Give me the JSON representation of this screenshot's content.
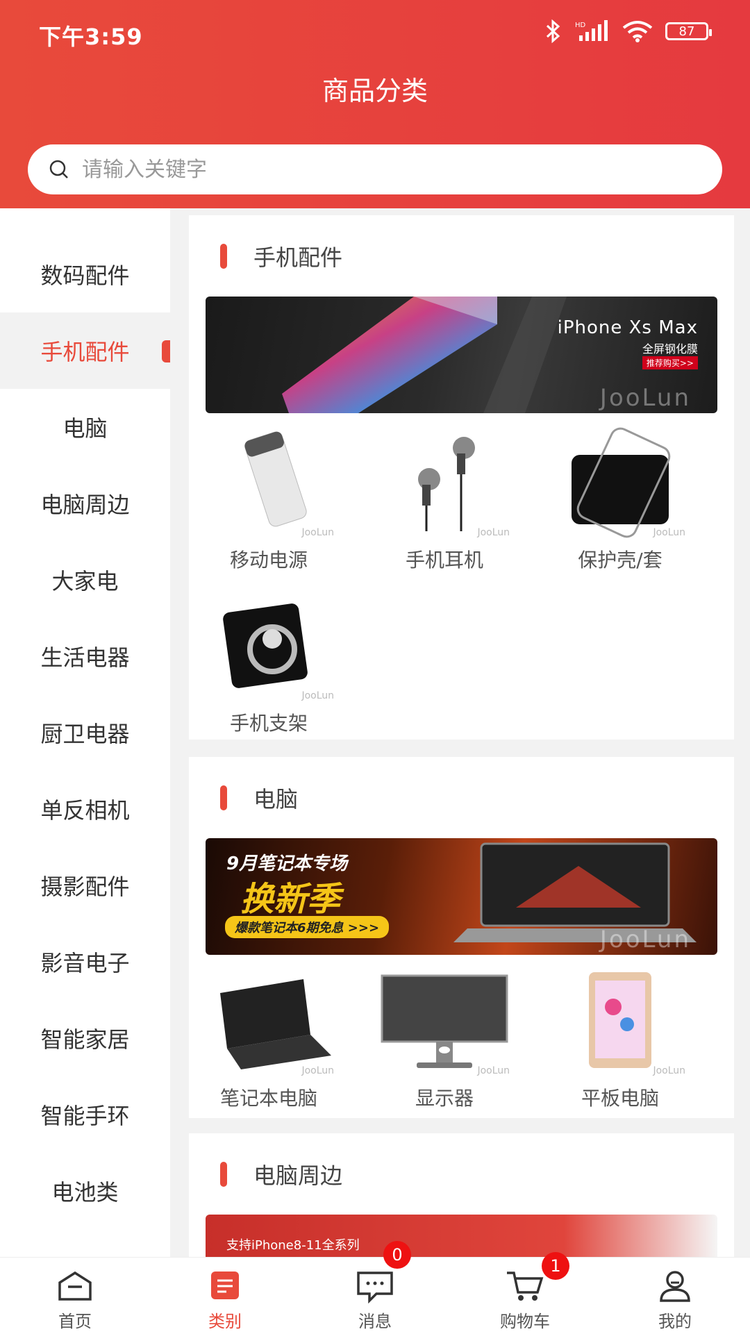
{
  "status_bar": {
    "time": "下午3:59",
    "battery": "87"
  },
  "header": {
    "title": "商品分类"
  },
  "search": {
    "placeholder": "请输入关键字"
  },
  "sidebar": {
    "items": [
      {
        "label": "数码配件"
      },
      {
        "label": "手机配件"
      },
      {
        "label": "电脑"
      },
      {
        "label": "电脑周边"
      },
      {
        "label": "大家电"
      },
      {
        "label": "生活电器"
      },
      {
        "label": "厨卫电器"
      },
      {
        "label": "单反相机"
      },
      {
        "label": "摄影配件"
      },
      {
        "label": "影音电子"
      },
      {
        "label": "智能家居"
      },
      {
        "label": "智能手环"
      },
      {
        "label": "电池类"
      }
    ],
    "active_index": 1
  },
  "sections": [
    {
      "title": "手机配件",
      "banner": {
        "headline": "iPhone Xs Max",
        "sub": "全屏钢化膜",
        "tag": "推荐购买>>",
        "watermark": "JooLun"
      },
      "items": [
        {
          "label": "移动电源",
          "icon": "power-bank"
        },
        {
          "label": "手机耳机",
          "icon": "earphones"
        },
        {
          "label": "保护壳/套",
          "icon": "phone-case"
        },
        {
          "label": "手机支架",
          "icon": "phone-ring-holder"
        }
      ]
    },
    {
      "title": "电脑",
      "banner": {
        "headline": "9月笔记本专场",
        "big": "换新季",
        "sub": "爆款笔记本6期免息 >>>",
        "watermark": "JooLun"
      },
      "items": [
        {
          "label": "笔记本电脑",
          "icon": "laptop"
        },
        {
          "label": "显示器",
          "icon": "monitor"
        },
        {
          "label": "平板电脑",
          "icon": "tablet"
        }
      ]
    },
    {
      "title": "电脑周边",
      "banner": {
        "headline": "支持iPhone8-11全系列"
      }
    }
  ],
  "thumb_watermark": "JooLun",
  "tabbar": {
    "tabs": [
      {
        "label": "首页",
        "icon": "home-icon"
      },
      {
        "label": "类别",
        "icon": "category-icon"
      },
      {
        "label": "消息",
        "icon": "message-icon",
        "badge": "0"
      },
      {
        "label": "购物车",
        "icon": "cart-icon",
        "badge": "1"
      },
      {
        "label": "我的",
        "icon": "profile-icon"
      }
    ],
    "active_index": 1
  },
  "colors": {
    "accent": "#e84a3b",
    "badge": "#ee1111",
    "background": "#f2f2f2"
  }
}
